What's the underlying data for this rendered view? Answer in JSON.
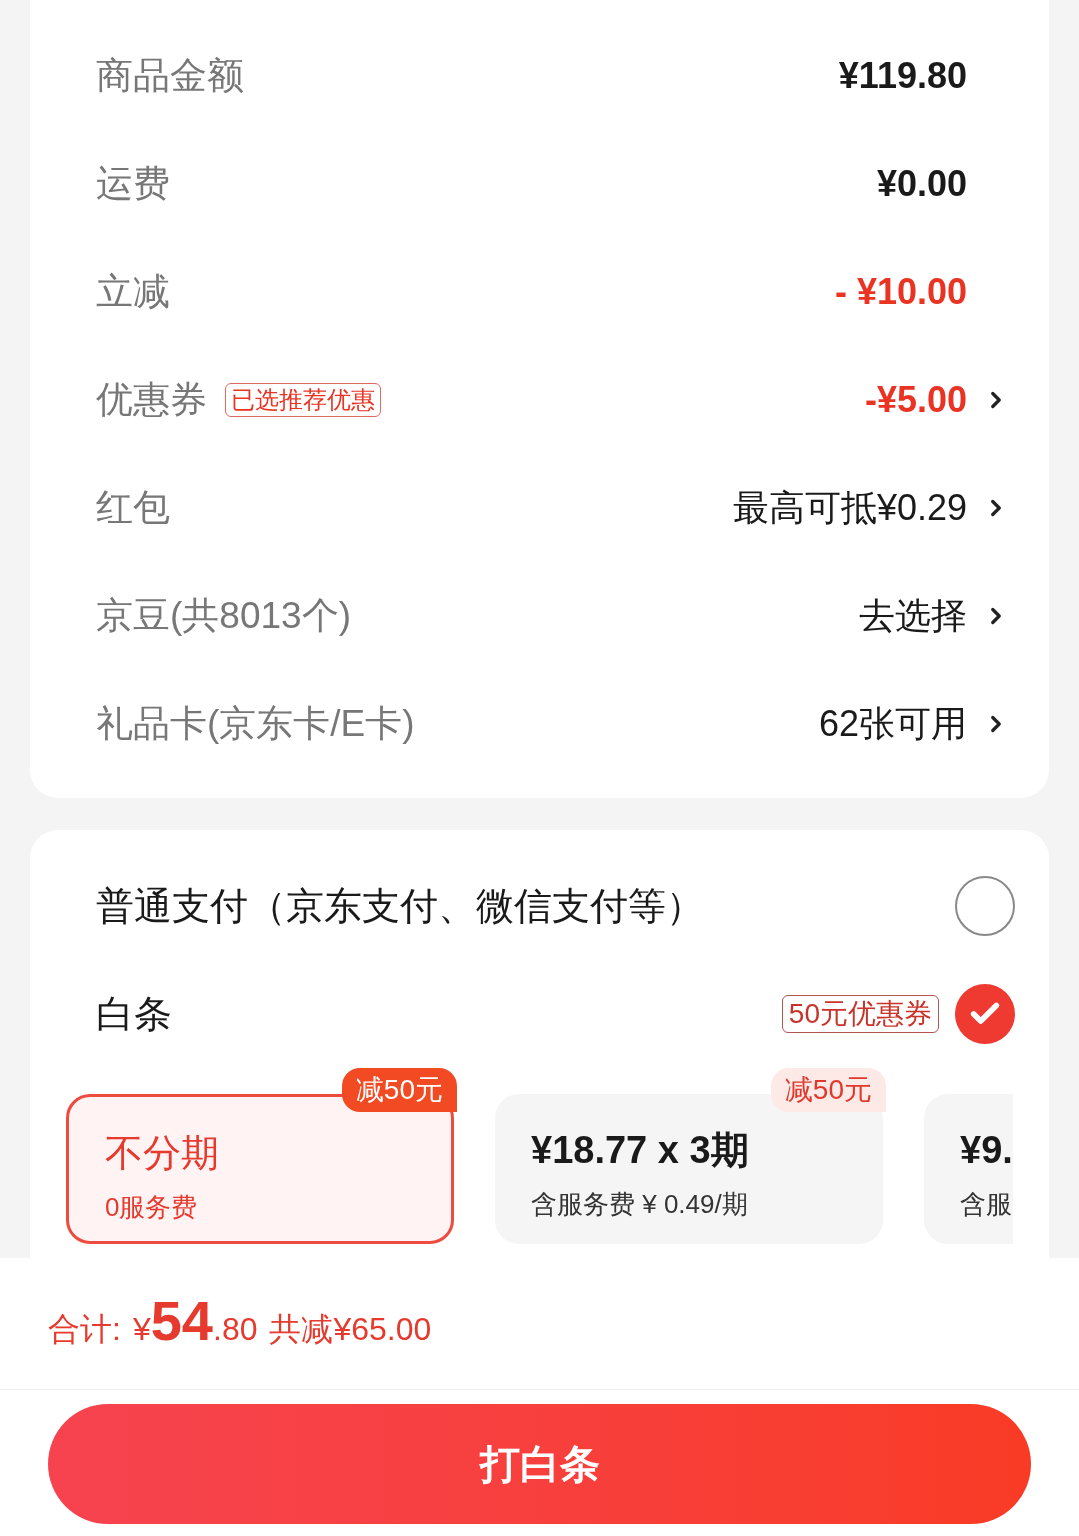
{
  "fees": [
    {
      "label": "商品金额",
      "value": "¥119.80",
      "kind": "normal",
      "has_arrow": false
    },
    {
      "label": "运费",
      "value": "¥0.00",
      "kind": "normal",
      "has_arrow": false
    },
    {
      "label": "立减",
      "value": "- ¥10.00",
      "kind": "discount",
      "has_arrow": false
    },
    {
      "label": "优惠券",
      "tag": "已选推荐优惠",
      "value": "-¥5.00",
      "kind": "discount",
      "has_arrow": true
    },
    {
      "label": "红包",
      "value": "最高可抵¥0.29",
      "kind": "plain",
      "has_arrow": true
    },
    {
      "label": "京豆(共8013个)",
      "value": "去选择",
      "kind": "plain",
      "has_arrow": true
    },
    {
      "label": "礼品卡(京东卡/E卡)",
      "value": "62张可用",
      "kind": "plain",
      "has_arrow": true
    }
  ],
  "payment_options": [
    {
      "label": "普通支付（京东支付、微信支付等）",
      "selected": false
    },
    {
      "label": "白条",
      "tag": "50元优惠券",
      "selected": true
    }
  ],
  "plans": [
    {
      "title": "不分期",
      "subtitle": "0服务费",
      "badge": "减50元",
      "selected": true
    },
    {
      "title": "¥18.77 x 3期",
      "subtitle": "含服务费 ¥ 0.49/期",
      "badge": "减50元",
      "selected": false
    },
    {
      "title": "¥9.",
      "subtitle": "含服",
      "selected": false
    }
  ],
  "total": {
    "label": "合计:",
    "currency": "¥",
    "integer": "54",
    "decimal": ".80",
    "saved": "共减¥65.00"
  },
  "submit_button": "打白条"
}
